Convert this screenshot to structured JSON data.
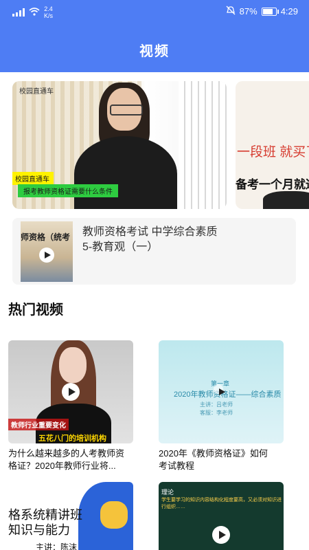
{
  "status_bar": {
    "network": "4G",
    "speed": "2.4\nK/s",
    "battery": "87%",
    "time": "4:29"
  },
  "header": {
    "title": "视频"
  },
  "banner": {
    "slides": [
      {
        "tag": "校园直通车",
        "label1": "校园直通车",
        "label2": "报考教师资格证需要什么条件"
      },
      {
        "text1": "一段班 就买了",
        "text2": "备考一个月就通过"
      }
    ]
  },
  "featured_card": {
    "thumb_text": "师资格（统考",
    "title": "教师资格考试 中学综合素质\n5-教育观（一）"
  },
  "hot_section": {
    "title": "热门视频"
  },
  "videos": [
    {
      "caption": "为什么越来越多的人考教师资\n格证？2020年教师行业将...",
      "label1": "教师行业重要变化",
      "label2": "五花八门的培训机构"
    },
    {
      "caption": "2020年《教师资格证》如何\n考试教程",
      "line1": "第一章",
      "line2": "2020年教师资格证——综合素质",
      "line3": "主讲：吕老师",
      "line4": "客服：李老师"
    },
    {
      "t1": "格系统精讲班",
      "t2": "知识与能力",
      "t3": "主讲：陈沫"
    },
    {
      "t1": "理论",
      "t2": "学生要学习的知识内容结构化程度要高，又必须对知识进行组织……"
    }
  ],
  "colors": {
    "header": "#4e7df4"
  }
}
